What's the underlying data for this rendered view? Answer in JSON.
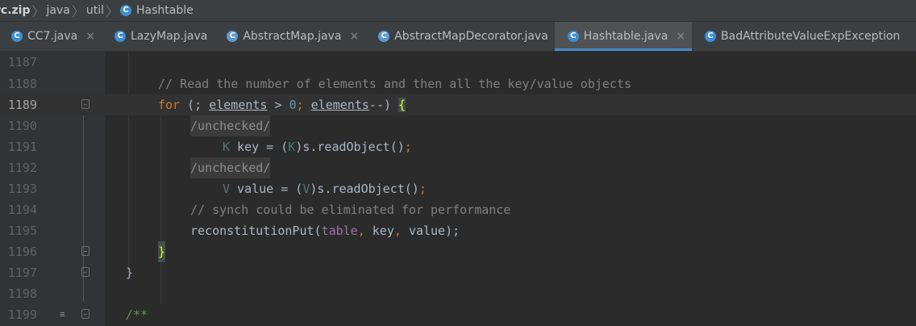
{
  "breadcrumb": {
    "items": [
      {
        "label": "rc.zip",
        "icon": ""
      },
      {
        "label": "java",
        "icon": ""
      },
      {
        "label": "util",
        "icon": ""
      },
      {
        "label": "Hashtable",
        "icon": "class-icon"
      }
    ]
  },
  "tabs": [
    {
      "label": "CC7.java",
      "icon": "class-runnable-icon",
      "active": false,
      "close": "×"
    },
    {
      "label": "LazyMap.java",
      "icon": "class-icon",
      "active": false,
      "close": ""
    },
    {
      "label": "AbstractMap.java",
      "icon": "abstract-class-icon",
      "active": false,
      "close": "×"
    },
    {
      "label": "AbstractMapDecorator.java",
      "icon": "abstract-class-icon",
      "active": false,
      "close": ""
    },
    {
      "label": "Hashtable.java",
      "icon": "class-icon",
      "active": true,
      "close": "×"
    },
    {
      "label": "BadAttributeValueExpException",
      "icon": "class-icon",
      "active": false,
      "close": ""
    }
  ],
  "editor": {
    "line_numbers": [
      "1187",
      "1188",
      "1189",
      "1190",
      "1191",
      "1192",
      "1193",
      "1194",
      "1195",
      "1196",
      "1197",
      "1198",
      "1199"
    ],
    "current_line": "1189",
    "code": {
      "l1188": "// Read the number of elements and then all the key/value objects",
      "l1189_for": "for",
      "l1189_open": " (; ",
      "l1189_var1": "elements",
      "l1189_gt": " > ",
      "l1189_zero": "0",
      "l1189_semi": "; ",
      "l1189_var2": "elements",
      "l1189_dec": "--) ",
      "l1189_brace": "{",
      "l1190": "/unchecked/",
      "l1191_type": "K",
      "l1191_rest1": " key = (",
      "l1191_cast": "K",
      "l1191_rest2": ")s.readObject()",
      "l1191_semi": ";",
      "l1192": "/unchecked/",
      "l1193_type": "V",
      "l1193_rest1": " value = (",
      "l1193_cast": "V",
      "l1193_rest2": ")s.readObject()",
      "l1193_semi": ";",
      "l1194": "// synch could be eliminated for performance",
      "l1195_call": "reconstitutionPut(",
      "l1195_table": "table",
      "l1195_c1": ", ",
      "l1195_key": "key",
      "l1195_c2": ", ",
      "l1195_value": "value",
      "l1195_end": ");",
      "l1196": "}",
      "l1197": "}",
      "l1199": "/**"
    }
  }
}
